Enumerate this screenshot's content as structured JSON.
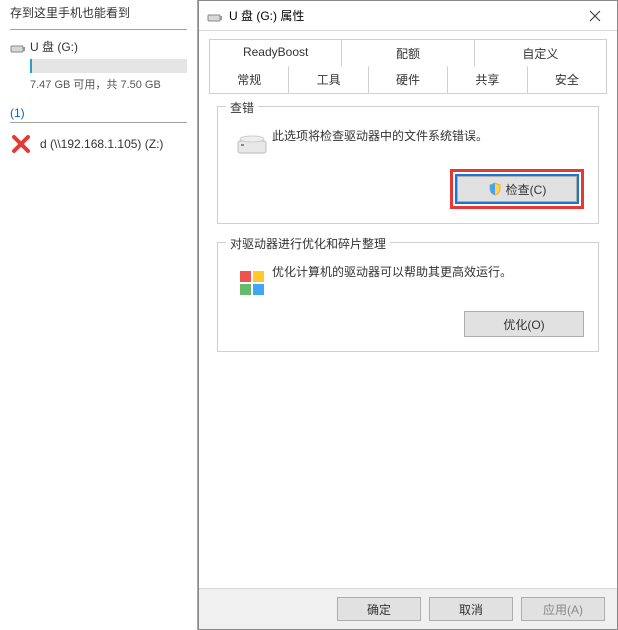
{
  "bg": {
    "partial": "存到这里手机也能看到",
    "drive_name": "U 盘 (G:)",
    "drive_sub": "7.47 GB 可用，共 7.50 GB",
    "group_head": "(1)",
    "net_drive": "d (\\\\192.168.1.105) (Z:)"
  },
  "dlg": {
    "title": "U 盘 (G:) 属性",
    "tabs_r1": [
      "ReadyBoost",
      "配额",
      "自定义"
    ],
    "tabs_r2": [
      "常规",
      "工具",
      "硬件",
      "共享",
      "安全"
    ],
    "active_tab": "工具",
    "check_group": {
      "title": "查错",
      "text": "此选项将检查驱动器中的文件系统错误。",
      "button": "检查(C)"
    },
    "opt_group": {
      "title": "对驱动器进行优化和碎片整理",
      "text": "优化计算机的驱动器可以帮助其更高效运行。",
      "button": "优化(O)"
    },
    "footer": {
      "ok": "确定",
      "cancel": "取消",
      "apply": "应用(A)"
    }
  }
}
